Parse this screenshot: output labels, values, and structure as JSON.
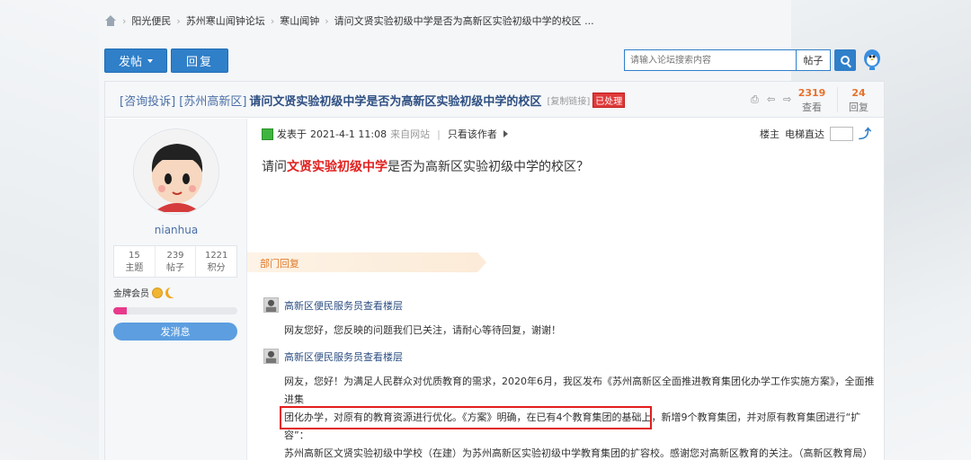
{
  "breadcrumb": [
    "阳光便民",
    "苏州寒山闻钟论坛",
    "寒山闻钟",
    "请问文贤实验初级中学是否为高新区实验初级中学的校区 ..."
  ],
  "toolbar": {
    "post_label": "发帖",
    "reply_label": "回复",
    "search_placeholder": "请输入论坛搜索内容",
    "search_type": "帖子"
  },
  "thread": {
    "category": "[咨询投诉] [苏州高新区]",
    "title": "请问文贤实验初级中学是否为高新区实验初级中学的校区",
    "copy_link": "[复制链接]",
    "status_badge": "已处理",
    "views": "2319",
    "views_label": "查看",
    "replies": "24",
    "replies_label": "回复"
  },
  "author": {
    "username": "nianhua",
    "stats": [
      {
        "value": "15",
        "label": "主题"
      },
      {
        "value": "239",
        "label": "帖子"
      },
      {
        "value": "1221",
        "label": "积分"
      }
    ],
    "rank": "金牌会员",
    "level_progress": 0.11,
    "message_button": "发消息"
  },
  "post": {
    "posted_prefix": "发表于",
    "date": "2021-4-1 11:08",
    "source": "来自网站",
    "only_author": "只看该作者",
    "floor_label": "楼主",
    "jump_label": "电梯直达",
    "content_pre": "请问",
    "content_highlight": "文贤实验初级中学",
    "content_post": "是否为高新区实验初级中学的校区？"
  },
  "department": {
    "banner": "部门回复",
    "replies": [
      {
        "author": "高新区便民服务员查看楼层",
        "text": "网友您好，您反映的问题我们已关注，请耐心等待回复，谢谢！"
      },
      {
        "author": "高新区便民服务员查看楼层",
        "line1": "网友，您好！为满足人民群众对优质教育的需求，2020年6月，我区发布《苏州高新区全面推进教育集团化办学工作实施方案》，全面推进集",
        "line2": "团化办学，对原有的教育资源进行优化。《方案》明确，在已有4个教育集团的基础上，新增9个教育集团，并对原有教育集团进行“扩容”：",
        "line3a": "苏州高新区文贤实验初级中学校（在建）为苏州高新区实验初级中学教育集团的扩容校。",
        "line3b": "感谢您对高新区教育的关注。（高新区教育局）"
      }
    ]
  },
  "colors": {
    "primary": "#2f7fc9",
    "highlight": "#e0201e",
    "stat_orange": "#e8712b",
    "banner_orange": "#e07a2a"
  }
}
